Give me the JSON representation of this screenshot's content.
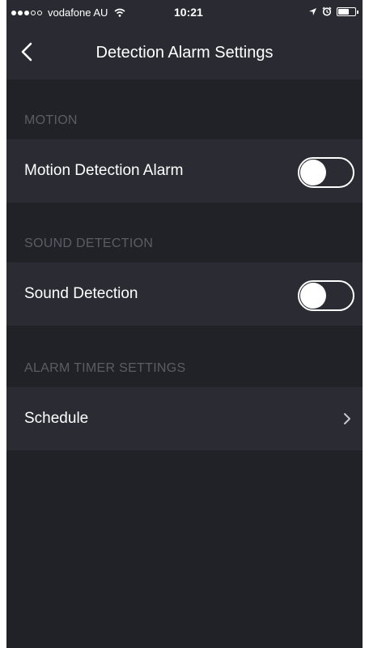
{
  "status_bar": {
    "carrier": "vodafone AU",
    "time": "10:21",
    "signal_strength": "3 of 5",
    "icons": [
      "wifi-icon",
      "location-icon",
      "alarm-icon",
      "battery-icon"
    ]
  },
  "nav": {
    "title": "Detection Alarm Settings",
    "back_icon": "chevron-left-icon"
  },
  "sections": {
    "motion": {
      "header": "MOTION",
      "row_label": "Motion Detection Alarm",
      "toggle_on": false
    },
    "sound": {
      "header": "SOUND DETECTION",
      "row_label": "Sound Detection",
      "toggle_on": false
    },
    "timer": {
      "header": "ALARM TIMER SETTINGS",
      "row_label": "Schedule",
      "row_icon": "chevron-right-icon"
    }
  },
  "colors": {
    "background": "#212228",
    "row_background": "#2b2c33",
    "header_text": "#5c5d64",
    "text": "#ffffff"
  }
}
